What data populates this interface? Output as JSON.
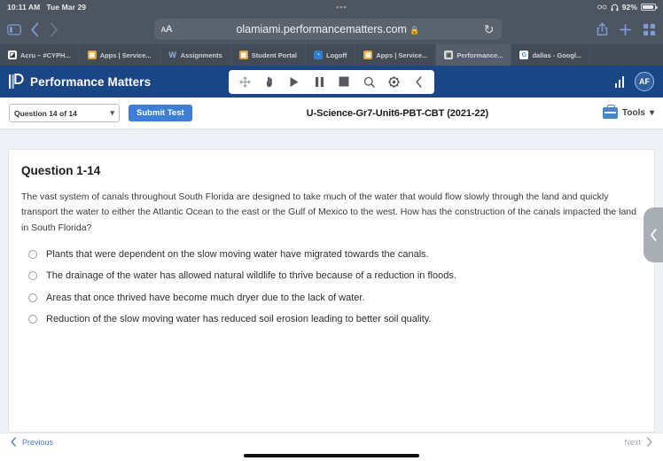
{
  "status_bar": {
    "time": "10:11 AM",
    "date": "Tue Mar 29",
    "center_dots": "•••",
    "battery_percent": "92%",
    "glasses_icon": "glasses-icon",
    "headphones_icon": "headphones-icon"
  },
  "browser": {
    "sidebar_icon": "sidebar-icon",
    "back_icon": "chevron-left-icon",
    "forward_icon": "chevron-right-icon",
    "reader_label": "AA",
    "url": "olamiami.performancematters.com",
    "lock_icon": "lock-icon",
    "reload_icon": "reload-icon",
    "share_icon": "share-icon",
    "new_tab_icon": "plus-icon",
    "tabs_icon": "tabs-grid-icon"
  },
  "bookmarks": [
    {
      "label": "Acru – #CYPH...",
      "favicon": "acru-favicon"
    },
    {
      "label": "Apps | Service...",
      "favicon": "apps-favicon"
    },
    {
      "label": "Assignments",
      "favicon": "word-favicon"
    },
    {
      "label": "Student Portal",
      "favicon": "portal-favicon"
    },
    {
      "label": "Logoff",
      "favicon": "logoff-favicon"
    },
    {
      "label": "Apps | Service...",
      "favicon": "apps-favicon"
    },
    {
      "label": "Performance...",
      "favicon": "performance-favicon"
    },
    {
      "label": "dallas - Googl...",
      "favicon": "google-favicon"
    }
  ],
  "app_header": {
    "brand": "Performance Matters",
    "tools": [
      {
        "name": "move-icon",
        "glyph": "✛"
      },
      {
        "name": "pointer-hand-icon",
        "glyph": "☝"
      },
      {
        "name": "play-icon",
        "glyph": "▶"
      },
      {
        "name": "pause-icon",
        "glyph": "❚❚"
      },
      {
        "name": "stop-icon",
        "glyph": "■"
      },
      {
        "name": "magnifier-icon",
        "glyph": "⌕"
      },
      {
        "name": "gear-icon",
        "glyph": "✷"
      },
      {
        "name": "collapse-left-icon",
        "glyph": "‹"
      }
    ],
    "chart_icon": "bar-chart-icon",
    "avatar_initials": "AF"
  },
  "sub_toolbar": {
    "question_select": "Question 14 of 14",
    "caret": "▾",
    "submit_label": "Submit Test",
    "test_name": "U-Science-Gr7-Unit6-PBT-CBT (2021-22)",
    "tools_label": "Tools",
    "tools_caret": "▾",
    "toolbox_icon": "toolbox-icon"
  },
  "question": {
    "heading": "Question 1-14",
    "text": "The vast system of canals throughout South Florida are designed to take much of the water that would flow slowly through the land and quickly transport the water to either the Atlantic Ocean to the east or the Gulf of Mexico to the west. How has the construction of the canals impacted the land in South Florida?",
    "options": [
      "Plants that were dependent on the slow moving water have migrated towards the canals.",
      "The drainage of the water has allowed natural wildlife to thrive because of a reduction in floods.",
      "Areas that once thrived have become much dryer due to the lack of water.",
      "Reduction of the slow moving water has reduced soil erosion leading to better soil quality."
    ],
    "side_tab_icon": "chevron-left-icon"
  },
  "bottom_nav": {
    "previous_label": "Previous",
    "previous_icon": "chevron-left-icon",
    "next_label": "Next",
    "next_icon": "chevron-right-icon"
  },
  "colors": {
    "brand_blue": "#1b4685",
    "accent_blue": "#3d7fd4",
    "status_bg": "#4d5560",
    "page_bg": "#eef1f6"
  }
}
